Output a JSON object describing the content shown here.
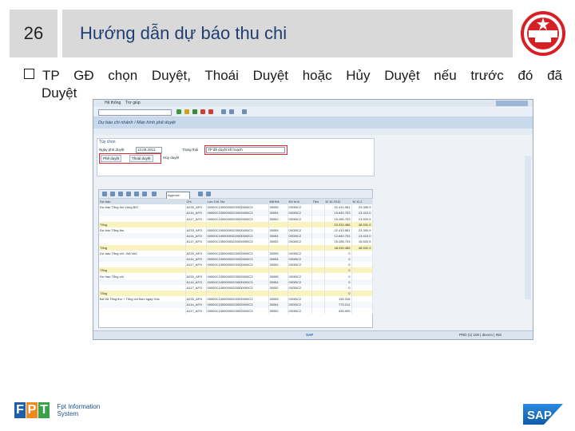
{
  "slide": {
    "number": "26",
    "title": "Hướng dẫn dự báo thu chi",
    "bullet_line1": "TP GĐ chọn Duyệt, Thoái Duyệt hoặc Hủy Duyệt nếu trước đó đã",
    "bullet_line2": "Duyệt"
  },
  "sap_window": {
    "menu": [
      "Hệ thống",
      "Trợ giúp"
    ],
    "screen_title": "Dự báo chi nhánh / Màn hình phê duyệt",
    "section_title": "Tùy chọn",
    "period_label": "Ngày phê duyệt",
    "period_value": "13.09.2012",
    "status_label": "Trạng thái",
    "status_value": "TP đã duyệt kế hoạch",
    "btn_approve": "Phê duyệt",
    "btn_revoke": "Thoái duyệt",
    "btn_cancel": "Hủy duyệt",
    "popup_text": "Approve",
    "columns": [
      "Dự báo",
      "Chi",
      "Lưu Ctrl. No",
      "Mã thẻ",
      "ĐV tính",
      "Tiền",
      "M 10.2012",
      "M 11.2"
    ],
    "rows": [
      {
        "c0": "Dự báo Tổng thu Vùng B/C",
        "c1": "A233_AFO",
        "c2": "00000C10000000220000000C3",
        "c3": "30055",
        "c4": "0XDBC2",
        "c5": "",
        "c6": "22.410.081",
        "c7": "23.300.9",
        "kind": "row"
      },
      {
        "c0": "",
        "c1": "A114_AFO",
        "c2": "00000C10000000220000000C3",
        "c3": "30054",
        "c4": "0XDBC2",
        "c5": "",
        "c6": "15.640.703",
        "c7": "13.410.0",
        "kind": "alt"
      },
      {
        "c0": "",
        "c1": "A117_AFO",
        "c2": "00000C10000000220000000C3",
        "c3": "30052",
        "c4": "0XDBC2",
        "c5": "",
        "c6": "15.285.703",
        "c7": "13.520.5",
        "kind": "row"
      },
      {
        "c0": "Tổng",
        "c1": "",
        "c2": "",
        "c3": "",
        "c4": "",
        "c5": "",
        "c6": "53.330.486",
        "c7": "48.531.9",
        "kind": "sum"
      },
      {
        "c0": "Dự báo Tổng thu",
        "c1": "A233_AFO",
        "c2": "00000C10000000220000000C3",
        "c3": "30055",
        "c4": "0XDBC2",
        "c5": "",
        "c6": "22.410.081",
        "c7": "23.300.9",
        "kind": "row"
      },
      {
        "c0": "",
        "c1": "A114_AFO",
        "c2": "00000C10000000220000000C3",
        "c3": "30054",
        "c4": "0XDBC2",
        "c5": "",
        "c6": "12.640.703",
        "c7": "13.410.0",
        "kind": "alt"
      },
      {
        "c0": "",
        "c1": "A117_AFO",
        "c2": "00000C10000000220000000C3",
        "c3": "30052",
        "c4": "0XDBC2",
        "c5": "",
        "c6": "15.285.703",
        "c7": "15.520.5",
        "kind": "row"
      },
      {
        "c0": "Tổng",
        "c1": "",
        "c2": "",
        "c3": "",
        "c4": "",
        "c5": "",
        "c6": "48.330.486",
        "c7": "48.531.9",
        "kind": "sum"
      },
      {
        "c0": "Dự báo Tổng chi - BA VAC",
        "c1": "A233_AFO",
        "c2": "00000C10000000220000000C3",
        "c3": "30055",
        "c4": "0XDBC2",
        "c5": "",
        "c6": "0",
        "c7": "",
        "kind": "row"
      },
      {
        "c0": "",
        "c1": "A114_AFO",
        "c2": "00000C10000000220000000C3",
        "c3": "30054",
        "c4": "0XDBC2",
        "c5": "",
        "c6": "0",
        "c7": "",
        "kind": "alt"
      },
      {
        "c0": "",
        "c1": "A117_AFO",
        "c2": "00000C10000000220000000C3",
        "c3": "30052",
        "c4": "0XDBC2",
        "c5": "",
        "c6": "0",
        "c7": "",
        "kind": "row"
      },
      {
        "c0": "Tổng",
        "c1": "",
        "c2": "",
        "c3": "",
        "c4": "",
        "c5": "",
        "c6": "0",
        "c7": "",
        "kind": "sum"
      },
      {
        "c0": "Dự báo Tổng chi",
        "c1": "A233_AFO",
        "c2": "00000C10000000220000000C3",
        "c3": "30055",
        "c4": "0XDBC2",
        "c5": "",
        "c6": "0",
        "c7": "",
        "kind": "row"
      },
      {
        "c0": "",
        "c1": "A114_AFO",
        "c2": "00000C10000000220000000C3",
        "c3": "30054",
        "c4": "0XDBC2",
        "c5": "",
        "c6": "0",
        "c7": "",
        "kind": "alt"
      },
      {
        "c0": "",
        "c1": "A117_AFO",
        "c2": "00000C10000000220000000C3",
        "c3": "30052",
        "c4": "0XDBC2",
        "c5": "",
        "c6": "0",
        "c7": "",
        "kind": "row"
      },
      {
        "c0": "Tổng",
        "c1": "",
        "c2": "",
        "c3": "",
        "c4": "",
        "c5": "",
        "c6": "0",
        "c7": "",
        "kind": "sum"
      },
      {
        "c0": "BA VA Tổng thu + Tổng chi theo ngày Gốc",
        "c1": "A233_AFO",
        "c2": "00000C10000000220000000C3",
        "c3": "30055",
        "c4": "0XDBC2",
        "c5": "",
        "c6": "130.316",
        "c7": "",
        "kind": "row"
      },
      {
        "c0": "",
        "c1": "A114_AFO",
        "c2": "00000C10000000220000000C3",
        "c3": "30054",
        "c4": "0XDBC2",
        "c5": "",
        "c6": "775.212",
        "c7": "",
        "kind": "alt"
      },
      {
        "c0": "",
        "c1": "A117_AFO",
        "c2": "00000C10000000220000000C3",
        "c3": "30052",
        "c4": "0XDBC2",
        "c5": "",
        "c6": "430.005",
        "c7": "",
        "kind": "row"
      }
    ],
    "statusbar_left": "SAP",
    "statusbar_right": "PRD (1) 100 | devcm | INS"
  },
  "footer": {
    "fpt_letters": [
      "F",
      "P",
      "T"
    ],
    "fpt_name_line1": "Fpt Information",
    "fpt_name_line2": "System",
    "sap_logo_text": "SAP"
  },
  "colors": {
    "title_text": "#1f3f73",
    "header_bg": "#d9d9d9",
    "fpt_blue": "#1f5ea8",
    "fpt_orange": "#f08a1c",
    "fpt_green": "#3aa14b",
    "sap_blue": "#1870c5",
    "highlight_red": "#e0262c"
  }
}
